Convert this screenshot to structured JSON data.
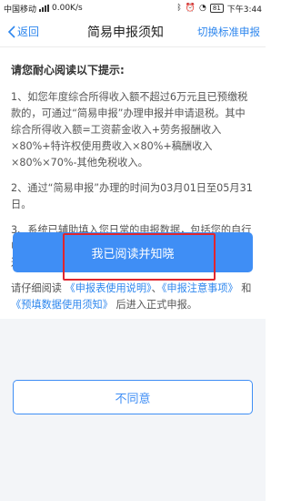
{
  "status_bar": {
    "carrier": "中国移动",
    "speed": "0.00K/s",
    "battery": "81",
    "time": "下午3:44"
  },
  "nav": {
    "back_label": "返回",
    "title": "简易申报须知",
    "switch_label": "切换标准申报"
  },
  "notice": {
    "heading": "请您耐心阅读以下提示:",
    "items": [
      "1、如您年度综合所得收入额不超过6万元且已预缴税款的，可通过“简易申报”办理申报并申请退税。其中综合所得收入额=工资薪金收入+劳务报酬收入×80%+特许权使用费收入×80%+稿酬收入×80%×70%-其他免税收入。",
      "2、通过“简易申报”办理的时间为03月01日至05月31日。",
      "3、系统已辅助填入您日常的申报数据，包括您的自行申报以及支付方的扣缴申报数据，如需修改，请通过“标准申报”办理。"
    ],
    "guide_prefix": "请仔细阅读",
    "link1": "《申报表使用说明》",
    "sep1": "、",
    "link2": "《申报注意事项》",
    "sep2": "和",
    "link3": "《预填数据使用须知》",
    "guide_suffix": "后进入正式申报。"
  },
  "buttons": {
    "agree_label": "我已阅读并知晓",
    "disagree_label": "不同意"
  },
  "colors": {
    "accent": "#3f8ef5",
    "link": "#2d86ee",
    "highlight": "#e0262e"
  }
}
